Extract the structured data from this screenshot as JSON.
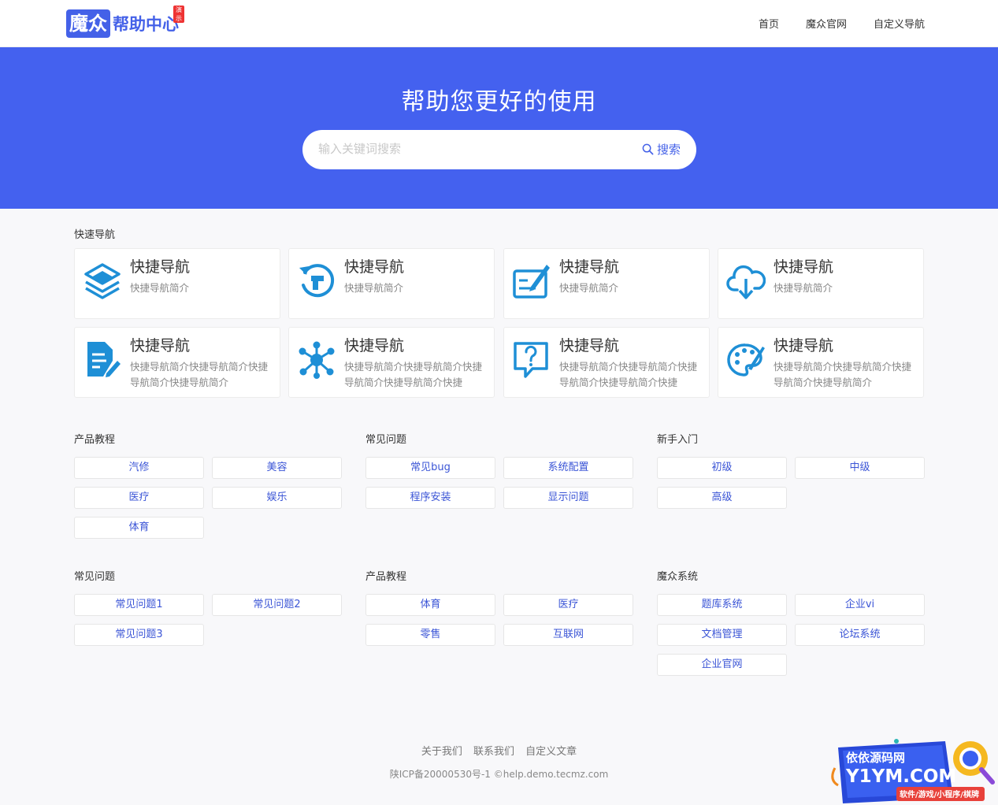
{
  "header": {
    "logo_box": "魔众",
    "logo_text": "帮助中心",
    "logo_badge": "演示",
    "nav": [
      "首页",
      "魔众官网",
      "自定义导航"
    ]
  },
  "hero": {
    "title": "帮助您更好的使用",
    "search_placeholder": "输入关键词搜索",
    "search_button": "搜索"
  },
  "quick_nav": {
    "title": "快速导航",
    "cards": [
      {
        "title": "快捷导航",
        "desc": "快捷导航简介",
        "icon": "layers-icon"
      },
      {
        "title": "快捷导航",
        "desc": "快捷导航简介",
        "icon": "refresh-icon"
      },
      {
        "title": "快捷导航",
        "desc": "快捷导航简介",
        "icon": "edit-board-icon"
      },
      {
        "title": "快捷导航",
        "desc": "快捷导航简介",
        "icon": "cloud-download-icon"
      },
      {
        "title": "快捷导航",
        "desc": "快捷导航简介快捷导航简介快捷导航简介快捷导航简介",
        "icon": "document-edit-icon"
      },
      {
        "title": "快捷导航",
        "desc": "快捷导航简介快捷导航简介快捷导航简介快捷导航简介快捷",
        "icon": "network-icon"
      },
      {
        "title": "快捷导航",
        "desc": "快捷导航简介快捷导航简介快捷导航简介快捷导航简介快捷",
        "icon": "question-icon"
      },
      {
        "title": "快捷导航",
        "desc": "快捷导航简介快捷导航简介快捷导航简介快捷导航简介",
        "icon": "palette-icon"
      }
    ]
  },
  "categories": [
    {
      "title": "产品教程",
      "items": [
        "汽修",
        "美容",
        "医疗",
        "娱乐",
        "体育"
      ]
    },
    {
      "title": "常见问题",
      "items": [
        "常见bug",
        "系统配置",
        "程序安装",
        "显示问题"
      ]
    },
    {
      "title": "新手入门",
      "items": [
        "初级",
        "中级",
        "高级"
      ]
    },
    {
      "title": "常见问题",
      "items": [
        "常见问题1",
        "常见问题2",
        "常见问题3"
      ]
    },
    {
      "title": "产品教程",
      "items": [
        "体育",
        "医疗",
        "零售",
        "互联网"
      ]
    },
    {
      "title": "魔众系统",
      "items": [
        "题库系统",
        "企业vi",
        "文档管理",
        "论坛系统",
        "企业官网"
      ]
    }
  ],
  "footer": {
    "links": [
      "关于我们",
      "联系我们",
      "自定义文章"
    ],
    "copyright": "陕ICP备20000530号-1 ©help.demo.tecmz.com"
  },
  "watermark": {
    "line1": "依依源码网",
    "line2": "Y1YM.COM",
    "line3": "软件/游戏/小程序/棋牌"
  },
  "colors": {
    "brand": "#4461e8",
    "hero_bg": "#4461ef",
    "icon": "#1e8fd6",
    "link": "#3b55d6"
  }
}
